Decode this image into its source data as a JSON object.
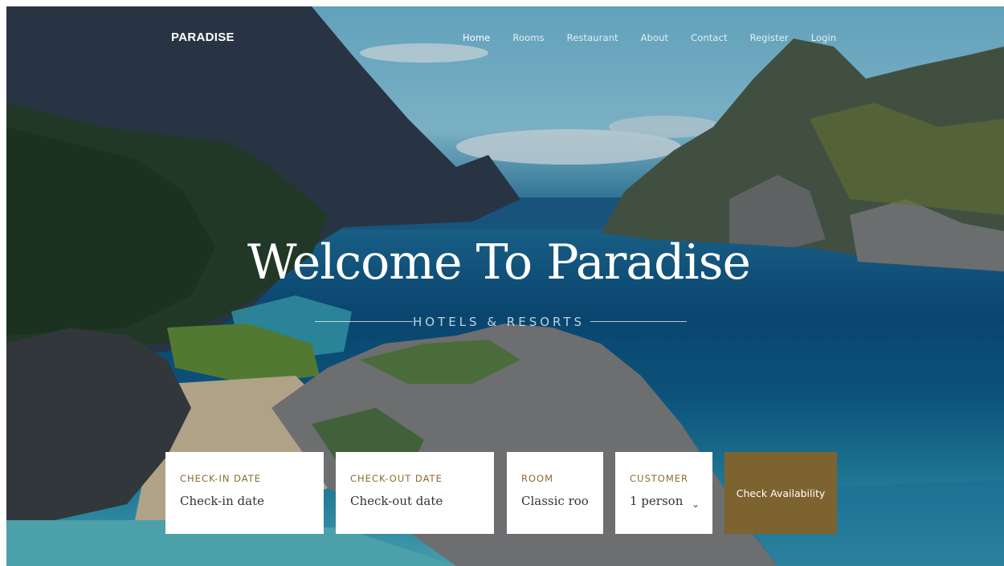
{
  "nav": {
    "brand": "PARADISE",
    "links": [
      "Home",
      "Rooms",
      "Restaurant",
      "About",
      "Contact",
      "Register",
      "Login"
    ]
  },
  "hero": {
    "title": "Welcome To Paradise",
    "subtitle": "HOTELS & RESORTS"
  },
  "booking": {
    "checkin": {
      "label": "CHECK-IN DATE",
      "placeholder": "Check-in date"
    },
    "checkout": {
      "label": "CHECK-OUT DATE",
      "placeholder": "Check-out date"
    },
    "room": {
      "label": "ROOM",
      "value": "Classic room"
    },
    "customer": {
      "label": "CUSTOMER",
      "value": "1 person"
    },
    "button": "Check Availability"
  },
  "colors": {
    "accent": "#7d6330",
    "label": "#8c6a2e"
  },
  "icons": {
    "select_arrow": "chevron-down-icon"
  }
}
